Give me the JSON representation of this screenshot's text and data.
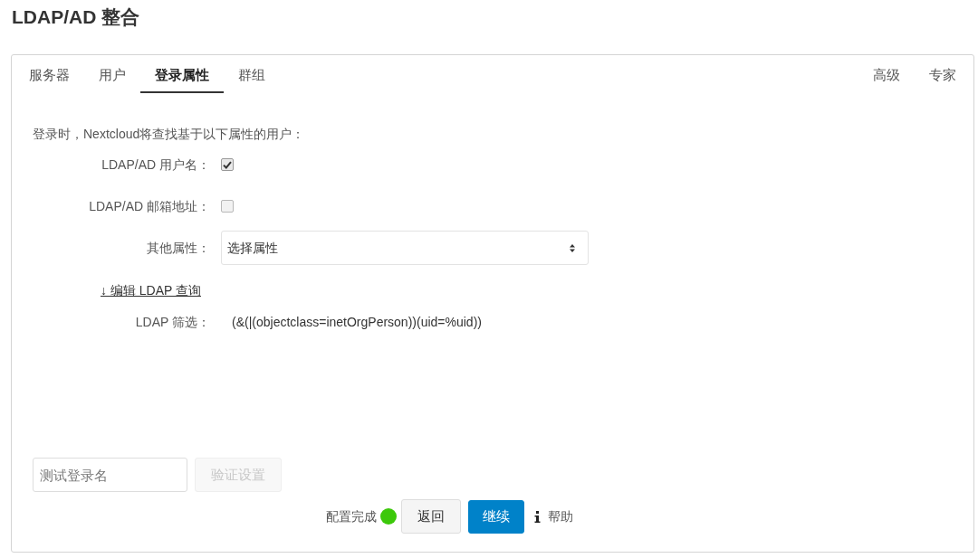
{
  "page": {
    "title": "LDAP/AD 整合"
  },
  "tabs": [
    {
      "label": "服务器",
      "selected": false
    },
    {
      "label": "用户",
      "selected": false
    },
    {
      "label": "登录属性",
      "selected": true
    },
    {
      "label": "群组",
      "selected": false
    }
  ],
  "side_tabs": [
    {
      "label": "高级",
      "selected": false
    },
    {
      "label": "专家",
      "selected": false
    }
  ],
  "intro": "登录时，Nextcloud将查找基于以下属性的用户：",
  "attributes": [
    {
      "kind": "checkbox",
      "label": "LDAP/AD 用户名：",
      "checked": true
    },
    {
      "kind": "checkbox",
      "label": "LDAP/AD 邮箱地址：",
      "checked": false
    },
    {
      "kind": "select",
      "label": "其他属性：",
      "value": "选择属性"
    }
  ],
  "edit_query_link": "↓ 编辑 LDAP 查询",
  "filter": {
    "label": "LDAP 筛选：",
    "value": "(&(|(objectclass=inetOrgPerson))(uid=%uid))"
  },
  "test": {
    "input": {
      "placeholder": "测试登录名"
    },
    "verify_button": {
      "label": "验证设置",
      "disabled": true
    }
  },
  "footer": {
    "status": {
      "label": "配置完成",
      "color": "#3cc80a"
    },
    "back_button": "返回",
    "continue_button": "继续",
    "help": "帮助"
  }
}
